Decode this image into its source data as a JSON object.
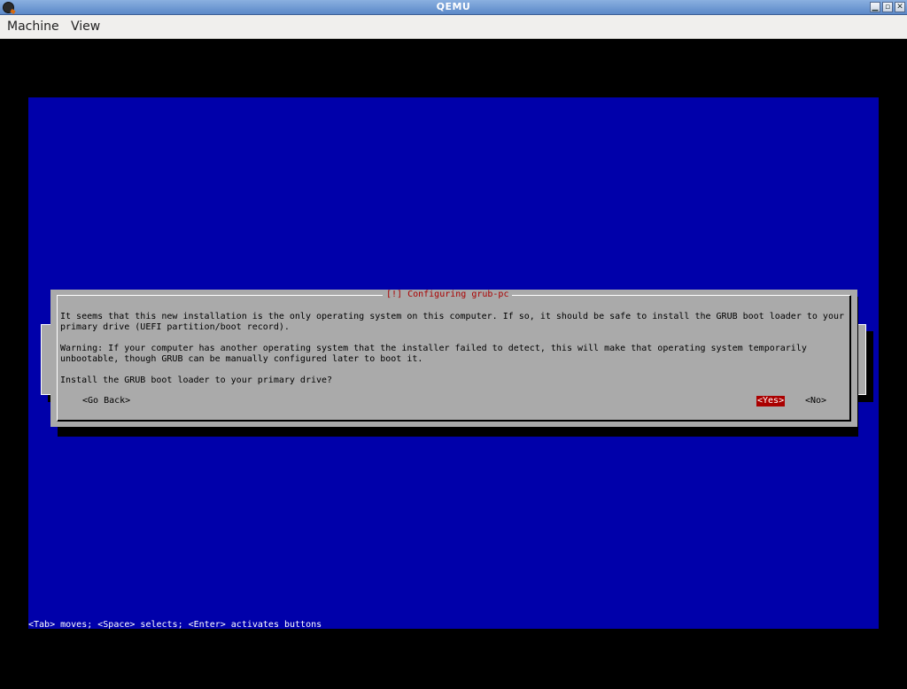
{
  "window": {
    "title": "QEMU",
    "controls": {
      "minimize": "▁",
      "maximize": "▫",
      "close": "✕"
    }
  },
  "menubar": {
    "items": [
      "Machine",
      "View"
    ]
  },
  "dialog": {
    "title": "[!] Configuring grub-pc",
    "lines": [
      "It seems that this new installation is the only operating system on this computer. If so, it should be safe to install the GRUB boot loader to your",
      "primary drive (UEFI partition/boot record).",
      "Warning: If your computer has another operating system that the installer failed to detect, this will make that operating system temporarily",
      "unbootable, though GRUB can be manually configured later to boot it.",
      "Install the GRUB boot loader to your primary drive?"
    ],
    "buttons": {
      "go_back": "<Go Back>",
      "yes": "<Yes>",
      "no": "<No>"
    }
  },
  "status_help": "<Tab> moves; <Space> selects; <Enter> activates buttons",
  "colors": {
    "screen_bg": "#0000aa",
    "dialog_bg": "#aaaaaa",
    "title_fg": "#aa0000",
    "selected_bg": "#aa0000"
  }
}
